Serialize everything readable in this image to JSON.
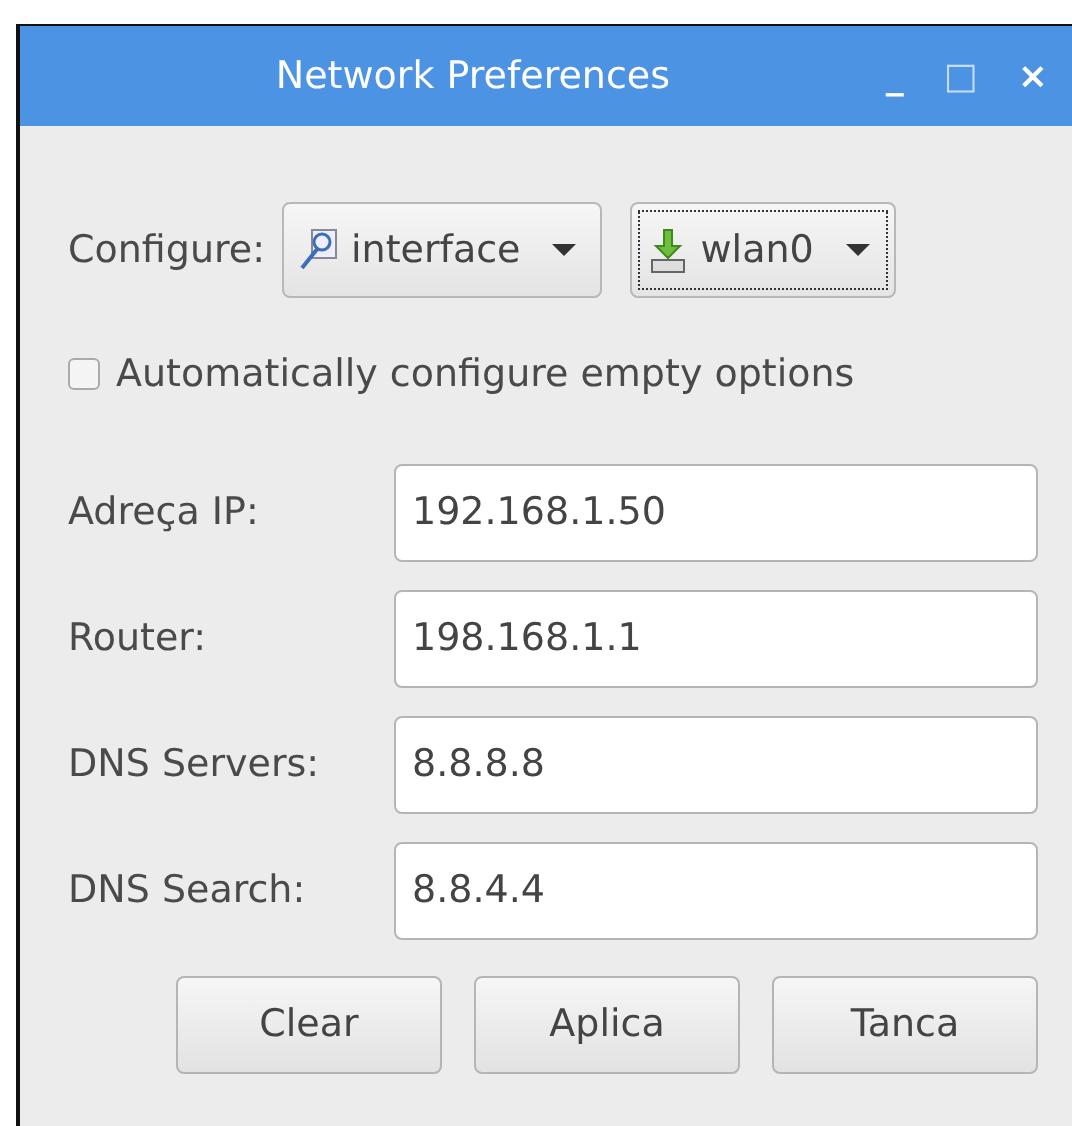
{
  "window": {
    "title": "Network Preferences",
    "controls": [
      "_",
      "□",
      "×"
    ]
  },
  "configure": {
    "label": "Configure:",
    "dropdowns": [
      {
        "value": "interface",
        "focused": false
      },
      {
        "value": "wlan0",
        "focused": true
      }
    ]
  },
  "auto_configure": {
    "label": "Automatically configure empty options",
    "checked": false
  },
  "fields": [
    {
      "label": "Adreça IP:",
      "value": "192.168.1.50"
    },
    {
      "label": "Router:",
      "value": "198.168.1.1"
    },
    {
      "label": "DNS Servers:",
      "value": "8.8.8.8"
    },
    {
      "label": "DNS Search:",
      "value": "8.8.4.4"
    }
  ],
  "buttons": [
    "Clear",
    "Aplica",
    "Tanca"
  ]
}
